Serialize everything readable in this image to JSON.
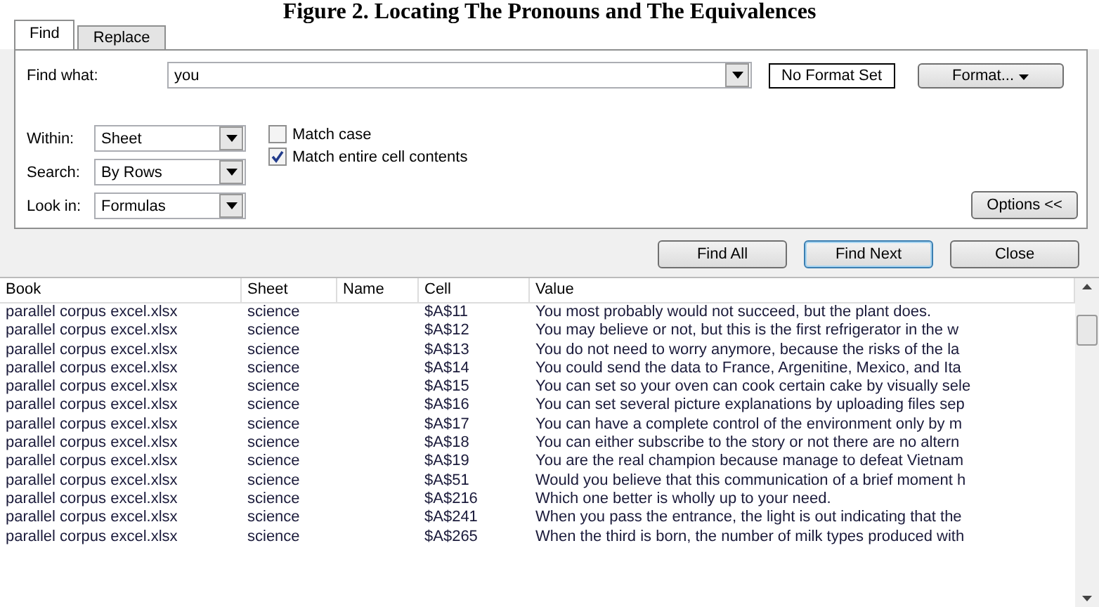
{
  "caption": "Figure 2. Locating The Pronouns and The Equivalences",
  "tabs": [
    {
      "label": "Find",
      "selected": true
    },
    {
      "label": "Replace",
      "selected": false
    }
  ],
  "find_what": {
    "label": "Find what:",
    "value": "you",
    "format_status": "No Format Set",
    "format_button": "Format..."
  },
  "options": [
    {
      "label": "Within:",
      "value": "Sheet"
    },
    {
      "label": "Search:",
      "value": "By Rows"
    },
    {
      "label": "Look in:",
      "value": "Formulas"
    }
  ],
  "checkboxes": [
    {
      "label": "Match case",
      "checked": false
    },
    {
      "label": "Match entire cell contents",
      "checked": true
    }
  ],
  "options_button": "Options <<",
  "buttons": [
    {
      "label": "Find All",
      "default": false
    },
    {
      "label": "Find Next",
      "default": true
    },
    {
      "label": "Close",
      "default": false
    }
  ],
  "results": {
    "columns": [
      "Book",
      "Sheet",
      "Name",
      "Cell",
      "Value"
    ],
    "rows": [
      [
        "parallel corpus excel.xlsx",
        "science",
        "",
        "$A$11",
        "You most probably would not succeed, but the plant does."
      ],
      [
        "parallel corpus excel.xlsx",
        "science",
        "",
        "$A$12",
        "You may believe or not, but this is the first refrigerator in the w"
      ],
      [
        "parallel corpus excel.xlsx",
        "science",
        "",
        "$A$13",
        "You do not need to worry anymore, because the risks of the la"
      ],
      [
        "parallel corpus excel.xlsx",
        "science",
        "",
        "$A$14",
        "You could send the data to France, Argenitine, Mexico, and Ita"
      ],
      [
        "parallel corpus excel.xlsx",
        "science",
        "",
        "$A$15",
        "You can set so your oven can cook certain cake by visually sele"
      ],
      [
        "parallel corpus excel.xlsx",
        "science",
        "",
        "$A$16",
        "You can set several picture explanations by uploading files sep"
      ],
      [
        "parallel corpus excel.xlsx",
        "science",
        "",
        "$A$17",
        "You can have a complete control of the environment only by m"
      ],
      [
        "parallel corpus excel.xlsx",
        "science",
        "",
        "$A$18",
        "You can either subscribe to the story or not there are no altern"
      ],
      [
        "parallel corpus excel.xlsx",
        "science",
        "",
        "$A$19",
        "You are the real champion because manage to defeat Vietnam"
      ],
      [
        "parallel corpus excel.xlsx",
        "science",
        "",
        "$A$51",
        "Would you believe that this communication of a brief moment h"
      ],
      [
        "parallel corpus excel.xlsx",
        "science",
        "",
        "$A$216",
        "Which one better is wholly up to your need."
      ],
      [
        "parallel corpus excel.xlsx",
        "science",
        "",
        "$A$241",
        "When you pass the entrance, the light is out indicating that the"
      ],
      [
        "parallel corpus excel.xlsx",
        "science",
        "",
        "$A$265",
        "When the third is born, the number of milk types produced with"
      ]
    ]
  }
}
